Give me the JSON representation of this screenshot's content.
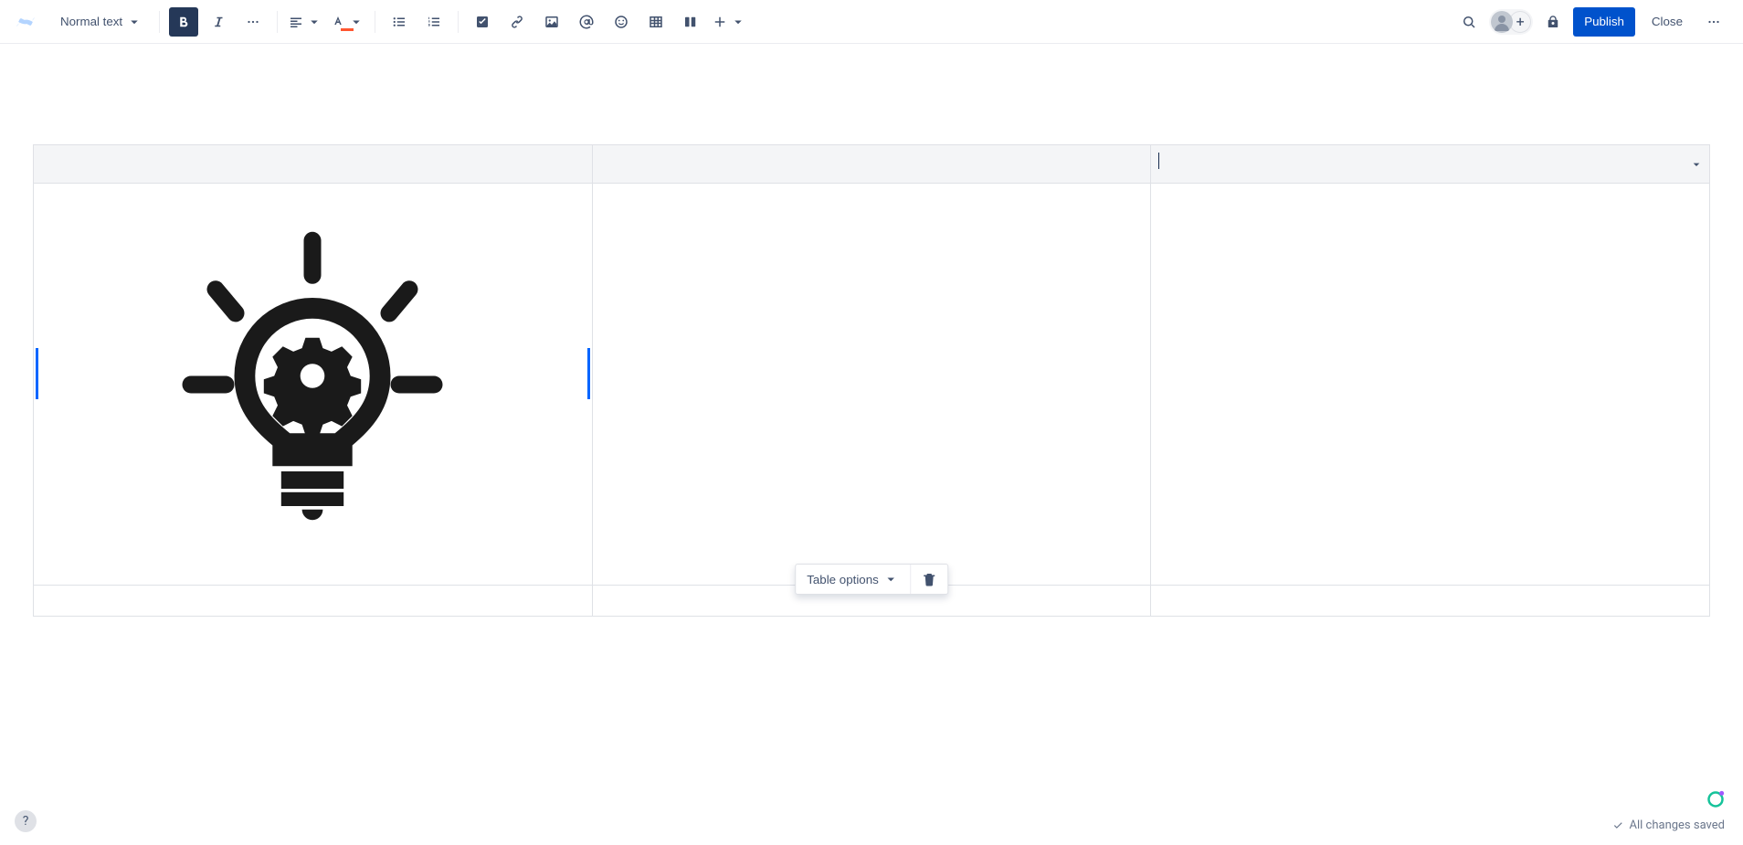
{
  "toolbar": {
    "text_style": "Normal text",
    "publish_label": "Publish",
    "close_label": "Close"
  },
  "table_floating": {
    "options_label": "Table options"
  },
  "status": {
    "saved_text": "All changes saved"
  },
  "content": {
    "image_alt": "lightbulb-gear-icon"
  }
}
